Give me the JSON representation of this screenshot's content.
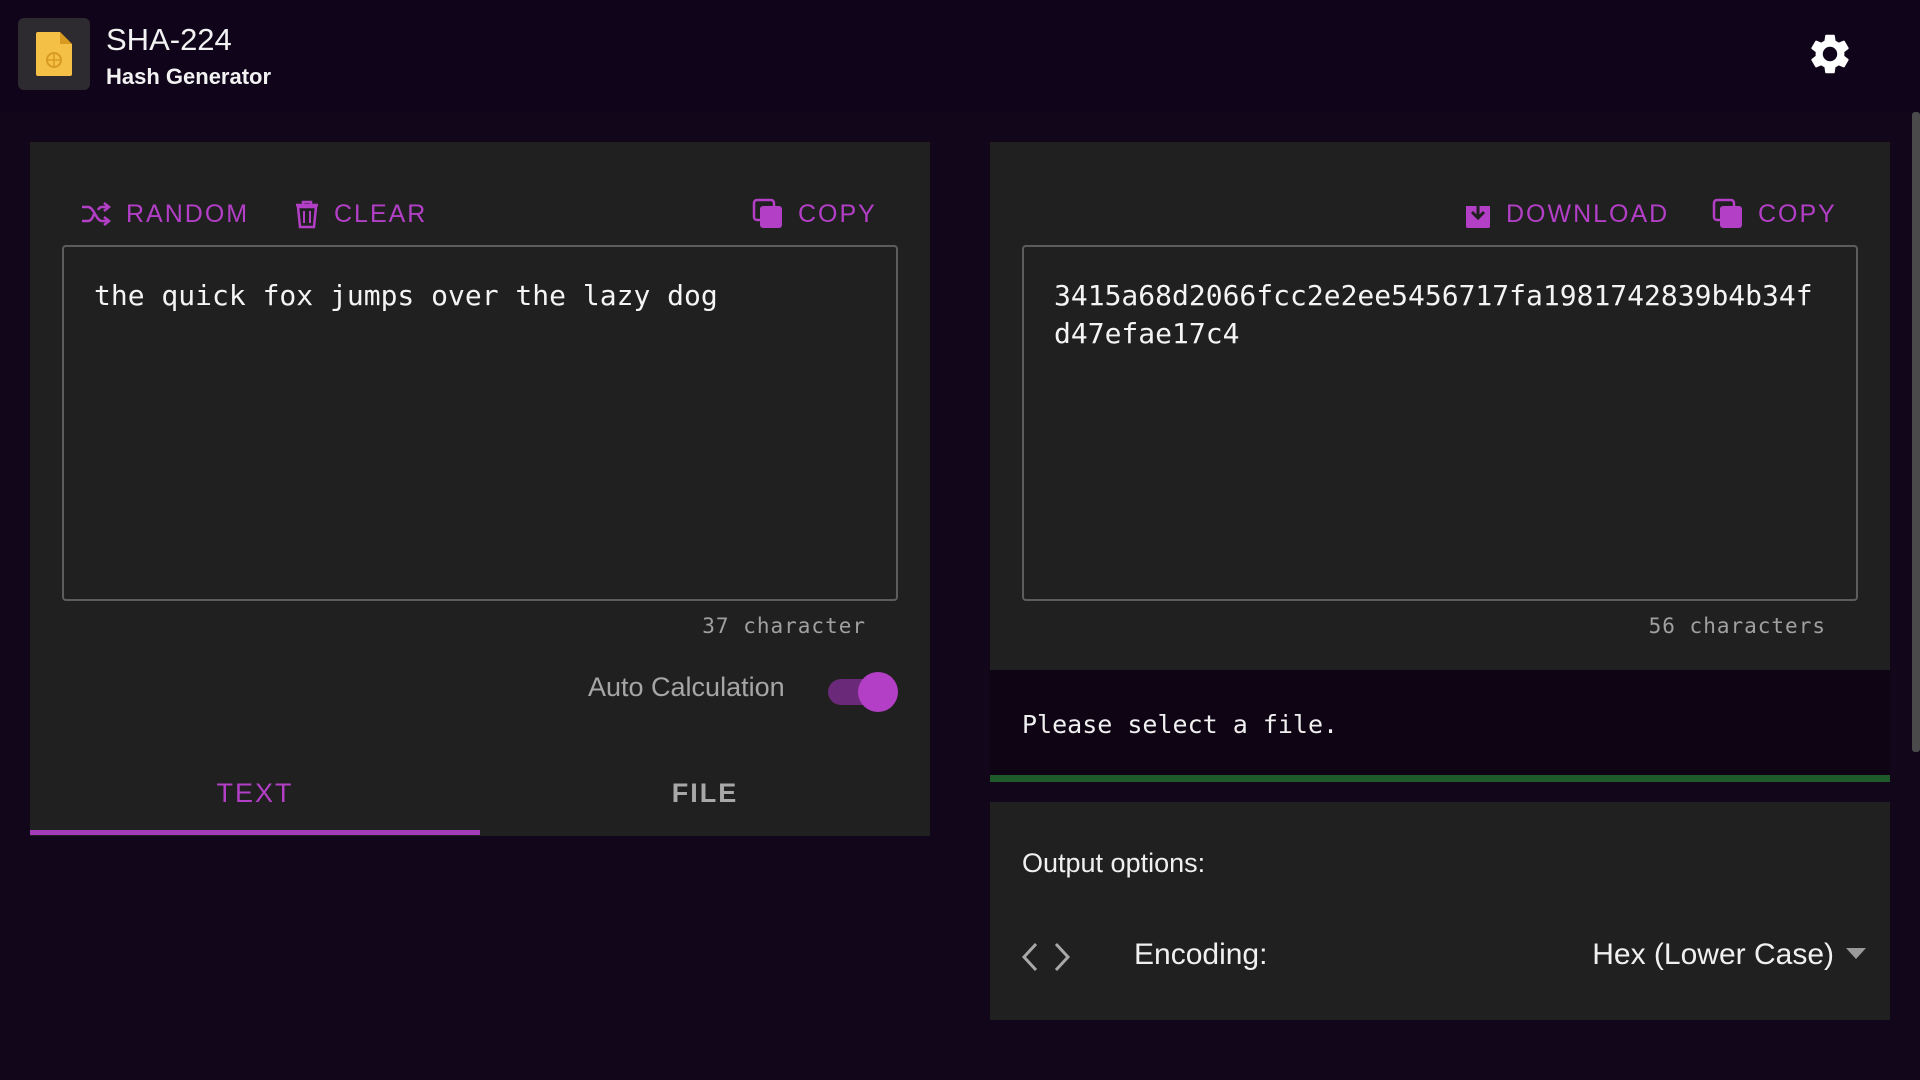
{
  "header": {
    "title": "SHA-224",
    "subtitle": "Hash Generator",
    "logo_icon": "file-hash-icon",
    "settings_icon": "gear-icon"
  },
  "input": {
    "random_label": "RANDOM",
    "clear_label": "CLEAR",
    "copy_label": "COPY",
    "text_value": "the quick fox jumps over the lazy dog",
    "char_count": "37 character",
    "auto_calc_label": "Auto Calculation",
    "auto_calc_on": true,
    "tabs": [
      {
        "label": "TEXT",
        "active": true
      },
      {
        "label": "FILE",
        "active": false
      }
    ]
  },
  "output": {
    "download_label": "DOWNLOAD",
    "copy_label": "COPY",
    "hash_value": "3415a68d2066fcc2e2ee5456717fa1981742839b4b34fd47efae17c4",
    "char_count": "56 characters",
    "status": "Please select a file."
  },
  "options": {
    "title": "Output options:",
    "encoding_label": "Encoding:",
    "encoding_value": "Hex (Lower Case)"
  },
  "colors": {
    "accent": "#b23fc6",
    "background": "#12061a",
    "panel": "#202020",
    "progress": "#1e5a2a"
  }
}
